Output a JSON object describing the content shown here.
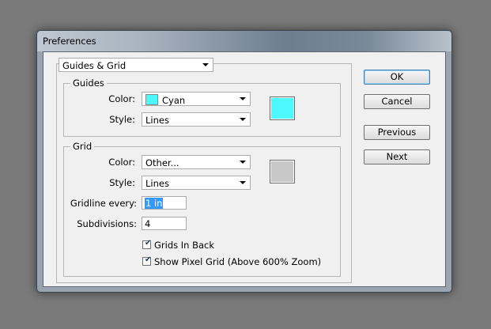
{
  "window": {
    "title": "Preferences"
  },
  "section_dropdown": {
    "value": "Guides & Grid"
  },
  "guides": {
    "group_label": "Guides",
    "color_label": "Color:",
    "color_value": "Cyan",
    "color_hex": "#4ef8ff",
    "style_label": "Style:",
    "style_value": "Lines"
  },
  "grid": {
    "group_label": "Grid",
    "color_label": "Color:",
    "color_value": "Other...",
    "color_hex": "#c8c8c8",
    "style_label": "Style:",
    "style_value": "Lines",
    "gridline_label": "Gridline every:",
    "gridline_value": "1 in",
    "subdivisions_label": "Subdivisions:",
    "subdivisions_value": "4",
    "grids_in_back_label": "Grids In Back",
    "grids_in_back_checked": true,
    "pixel_grid_label": "Show Pixel Grid (Above 600% Zoom)",
    "pixel_grid_checked": true
  },
  "buttons": {
    "ok": "OK",
    "cancel": "Cancel",
    "previous": "Previous",
    "next": "Next"
  }
}
